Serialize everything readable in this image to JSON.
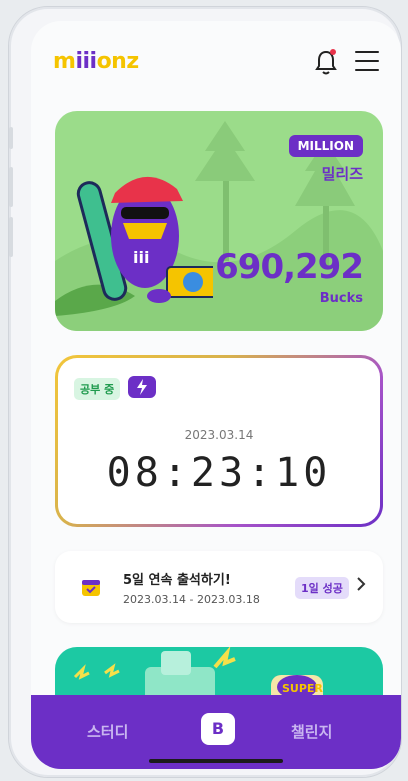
{
  "header": {
    "logo": "millionz",
    "bell_icon": "bell-icon",
    "menu_icon": "hamburger-menu-icon"
  },
  "balance_card": {
    "badge": "MILLION",
    "name": "밀리즈",
    "amount": "690,292",
    "unit": "Bucks"
  },
  "study_timer": {
    "status": "공부 중",
    "date": "2023.03.14",
    "time": "08:23:10"
  },
  "attendance": {
    "title": "5일 연속 출석하기!",
    "period": "2023.03.14 - 2023.03.18",
    "badge": "1일 성공"
  },
  "promo": {
    "label": "SUPER"
  },
  "bottom_nav": {
    "study": "스터디",
    "center": "B",
    "challenge": "챌린지"
  },
  "colors": {
    "brand_purple": "#6c2fc6",
    "brand_yellow": "#f5c400",
    "card_green": "#9bdc8a",
    "promo_teal": "#1cc9a3"
  }
}
